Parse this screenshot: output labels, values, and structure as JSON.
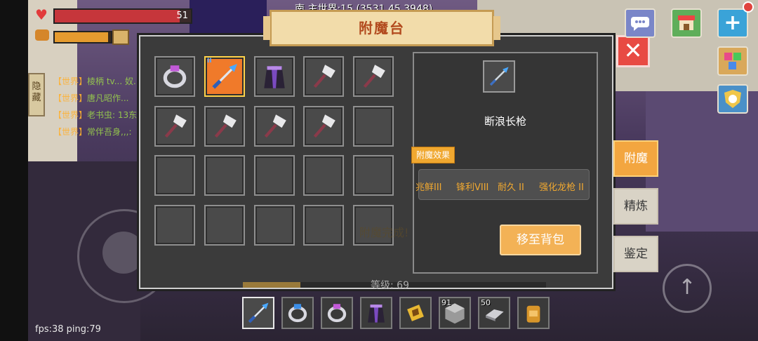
{
  "hud": {
    "hp_value": "51",
    "hp_fraction": 0.92,
    "food_fraction": 0.95,
    "coords_text": "南 主世界:15 (3531,45,3948)"
  },
  "chat": {
    "hide_label": "隐藏",
    "lines": [
      {
        "channel": "【世界】",
        "text": "棱柄 tv...   奴..."
      },
      {
        "channel": "【世界】",
        "text": "唐凡昭作..."
      },
      {
        "channel": "【世界】",
        "text": "老书虫:  13东..."
      },
      {
        "channel": "【世界】",
        "text": "常伴吾身,,,:"
      }
    ]
  },
  "panel": {
    "title": "附魔台",
    "close_label": "✕",
    "done_text": "附魔完成!",
    "level_text": "等级:  69",
    "level_fraction": 0.19
  },
  "inventory": [
    {
      "icon": "ring-icon",
      "selected": false,
      "badge": ""
    },
    {
      "icon": "spear-icon",
      "selected": true,
      "badge": "II"
    },
    {
      "icon": "robe-icon",
      "selected": false,
      "badge": ""
    },
    {
      "icon": "shovel-icon",
      "selected": false,
      "badge": ""
    },
    {
      "icon": "shovel-icon",
      "selected": false,
      "badge": ""
    },
    {
      "icon": "shovel-icon",
      "selected": false,
      "badge": ""
    },
    {
      "icon": "shovel-icon",
      "selected": false,
      "badge": ""
    },
    {
      "icon": "shovel-icon",
      "selected": false,
      "badge": ""
    },
    {
      "icon": "shovel-icon",
      "selected": false,
      "badge": ""
    },
    {
      "icon": "empty",
      "selected": false,
      "badge": ""
    },
    {
      "icon": "empty",
      "selected": false,
      "badge": ""
    },
    {
      "icon": "empty",
      "selected": false,
      "badge": ""
    },
    {
      "icon": "empty",
      "selected": false,
      "badge": ""
    },
    {
      "icon": "empty",
      "selected": false,
      "badge": ""
    },
    {
      "icon": "empty",
      "selected": false,
      "badge": ""
    },
    {
      "icon": "empty",
      "selected": false,
      "badge": ""
    },
    {
      "icon": "empty",
      "selected": false,
      "badge": ""
    },
    {
      "icon": "empty",
      "selected": false,
      "badge": ""
    },
    {
      "icon": "empty",
      "selected": false,
      "badge": ""
    },
    {
      "icon": "empty",
      "selected": false,
      "badge": ""
    }
  ],
  "detail": {
    "icon": "spear-icon",
    "item_name": "断浪长枪",
    "effect_label": "附魔效果",
    "enchantments": [
      "兆鲜III",
      "锋利VIII",
      "耐久 II",
      "强化龙枪 II"
    ],
    "move_label": "移至背包"
  },
  "side_tabs": [
    {
      "label": "附魔",
      "active": true
    },
    {
      "label": "精炼",
      "active": false
    },
    {
      "label": "鉴定",
      "active": false
    }
  ],
  "hotbar": [
    {
      "icon": "spear-icon",
      "count": "",
      "selected": true
    },
    {
      "icon": "blue-ring-icon",
      "count": "",
      "selected": false
    },
    {
      "icon": "ring-icon",
      "count": "",
      "selected": false
    },
    {
      "icon": "robe-icon",
      "count": "",
      "selected": false
    },
    {
      "icon": "gold-tablet-icon",
      "count": "",
      "selected": false
    },
    {
      "icon": "stone-block-icon",
      "count": "91",
      "selected": false
    },
    {
      "icon": "iron-ingot-icon",
      "count": "50",
      "selected": false
    },
    {
      "icon": "backpack-icon",
      "count": "",
      "selected": false
    }
  ],
  "status": {
    "fps_text": "fps:38 ping:79"
  },
  "colors": {
    "accent": "#f3a640",
    "enchant_text": "#f0a830",
    "selected_slot": "#f07a2a"
  }
}
